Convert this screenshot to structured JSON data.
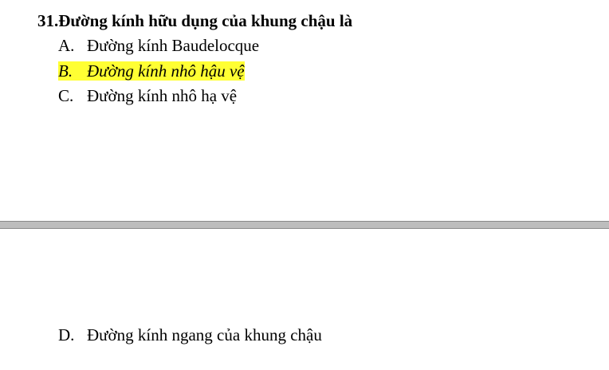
{
  "question": {
    "number": "31.",
    "text": "Đường kính hữu dụng của khung chậu là"
  },
  "options": [
    {
      "letter": "A.",
      "text": "Đường kính Baudelocque"
    },
    {
      "letter": "B.",
      "text": "Đường kính nhô hậu vệ"
    },
    {
      "letter": "C.",
      "text": "Đường kính nhô hạ vệ"
    },
    {
      "letter": "D.",
      "text": "Đường kính ngang của khung chậu"
    }
  ],
  "colors": {
    "highlight": "#ffff33",
    "page_gap": "#bdbdbd",
    "text": "#000000"
  }
}
